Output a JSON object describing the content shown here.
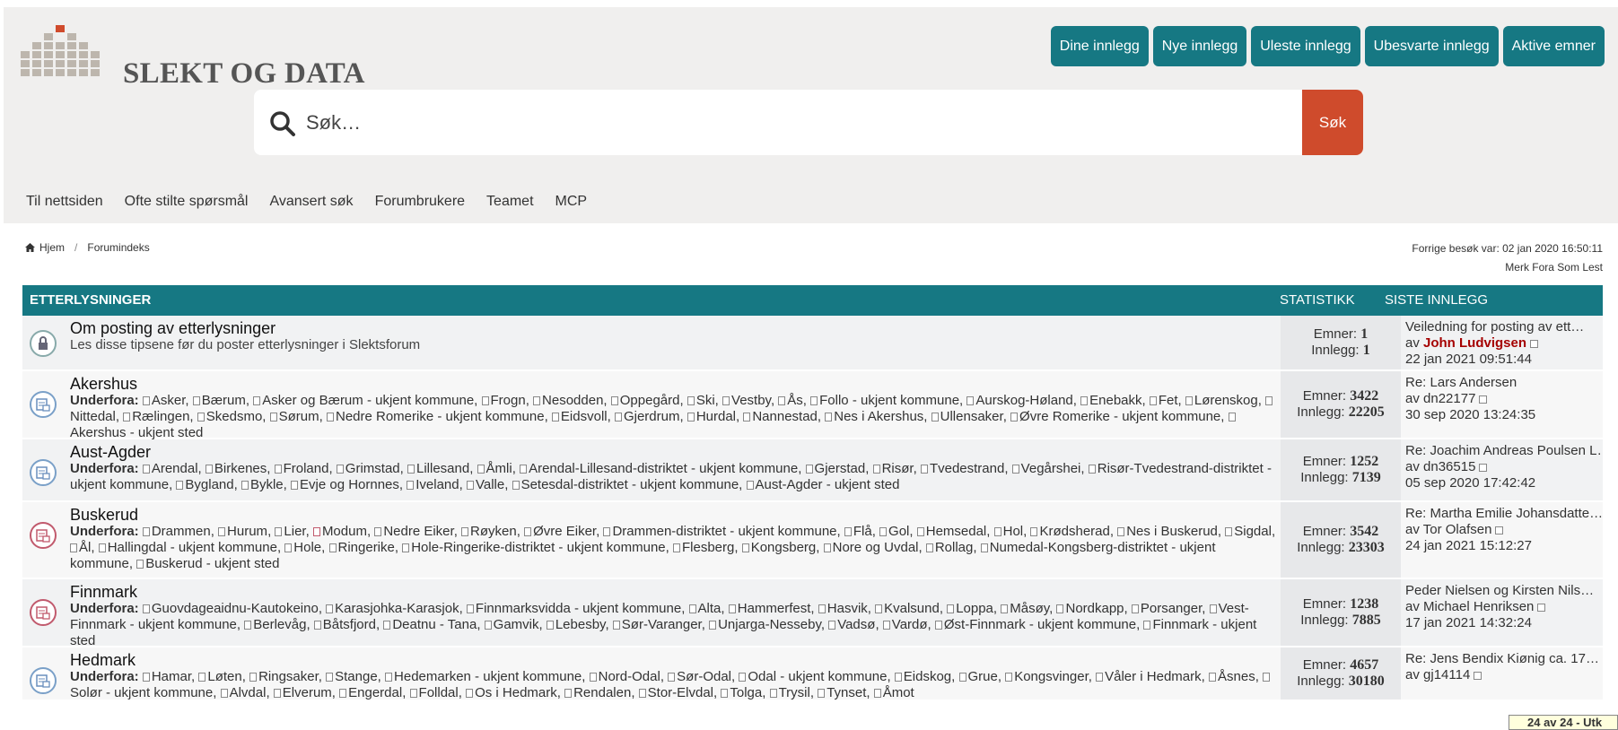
{
  "brand": {
    "name": "SLEKT OG DATA"
  },
  "quick_links": [
    "Dine innlegg",
    "Nye innlegg",
    "Uleste innlegg",
    "Ubesvarte innlegg",
    "Aktive emner"
  ],
  "search": {
    "placeholder": "Søk…",
    "button": "Søk"
  },
  "nav": [
    "Til nettsiden",
    "Ofte stilte spørsmål",
    "Avansert søk",
    "Forumbrukere",
    "Teamet",
    "MCP"
  ],
  "breadcrumb": {
    "home": "Hjem",
    "current": "Forumindeks"
  },
  "last_visit": "Forrige besøk var: 02 jan 2020 16:50:11",
  "mark_read": "Merk Fora Som Lest",
  "table_header": {
    "title": "ETTERLYSNINGER",
    "stats": "STATISTIKK",
    "last": "SISTE INNLEGG"
  },
  "labels": {
    "subforums": "Underfora:",
    "topics": "Emner:",
    "posts": "Innlegg:",
    "by": "av"
  },
  "forums": [
    {
      "title": "Om posting av etterlysninger",
      "description": "Les disse tipsene før du poster etterlysninger i Slektsforum",
      "topics": "1",
      "posts": "1",
      "last_title": "Veiledning for posting av ett…",
      "last_author": "John Ludvigsen",
      "last_date": "22 jan 2021 09:51:44"
    },
    {
      "title": "Akershus",
      "subforums": [
        "Asker",
        "Bærum",
        "Asker og Bærum - ukjent kommune",
        "Frogn",
        "Nesodden",
        "Oppegård",
        "Ski",
        "Vestby",
        "Ås",
        "Follo - ukjent kommune",
        "Aurskog-Høland",
        "Enebakk",
        "Fet",
        "Lørenskog",
        "Nittedal",
        "Rælingen",
        "Skedsmo",
        "Sørum",
        "Nedre Romerike - ukjent kommune",
        "Eidsvoll",
        "Gjerdrum",
        "Hurdal",
        "Nannestad",
        "Nes i Akershus",
        "Ullensaker",
        "Øvre Romerike - ukjent kommune",
        "Akershus - ukjent sted"
      ],
      "topics": "3422",
      "posts": "22205",
      "last_title": "Re: Lars Andersen",
      "last_author": "dn22177",
      "last_date": "30 sep 2020 13:24:35"
    },
    {
      "title": "Aust-Agder",
      "subforums": [
        "Arendal",
        "Birkenes",
        "Froland",
        "Grimstad",
        "Lillesand",
        "Åmli",
        "Arendal-Lillesand-distriktet - ukjent kommune",
        "Gjerstad",
        "Risør",
        "Tvedestrand",
        "Vegårshei",
        "Risør-Tvedestrand-distriktet - ukjent kommune",
        "Bygland",
        "Bykle",
        "Evje og Hornnes",
        "Iveland",
        "Valle",
        "Setesdal-distriktet - ukjent kommune",
        "Aust-Agder - ukjent sted"
      ],
      "topics": "1252",
      "posts": "7139",
      "last_title": "Re: Joachim Andreas Poulsen L…",
      "last_author": "dn36515",
      "last_date": "05 sep 2020 17:42:42"
    },
    {
      "title": "Buskerud",
      "subforums": [
        "Drammen",
        "Hurum",
        "Lier",
        "Modum",
        "Nedre Eiker",
        "Røyken",
        "Øvre Eiker",
        "Drammen-distriktet - ukjent kommune",
        "Flå",
        "Gol",
        "Hemsedal",
        "Hol",
        "Krødsherad",
        "Nes i Buskerud",
        "Sigdal",
        "Ål",
        "Hallingdal - ukjent kommune",
        "Hole",
        "Ringerike",
        "Hole-Ringerike-distriktet - ukjent kommune",
        "Flesberg",
        "Kongsberg",
        "Nore og Uvdal",
        "Rollag",
        "Numedal-Kongsberg-distriktet - ukjent kommune",
        "Buskerud - ukjent sted"
      ],
      "topics": "3542",
      "posts": "23303",
      "last_title": "Re: Martha Emilie Johansdatte…",
      "last_author": "Tor Olafsen",
      "last_date": "24 jan 2021 15:12:27"
    },
    {
      "title": "Finnmark",
      "subforums": [
        "Guovdageaidnu-Kautokeino",
        "Karasjohka-Karasjok",
        "Finnmarksvidda - ukjent kommune",
        "Alta",
        "Hammerfest",
        "Hasvik",
        "Kvalsund",
        "Loppa",
        "Måsøy",
        "Nordkapp",
        "Porsanger",
        "Vest-Finnmark - ukjent kommune",
        "Berlevåg",
        "Båtsfjord",
        "Deatnu - Tana",
        "Gamvik",
        "Lebesby",
        "Sør-Varanger",
        "Unjarga-Nesseby",
        "Vadsø",
        "Vardø",
        "Øst-Finnmark - ukjent kommune",
        "Finnmark - ukjent sted"
      ],
      "topics": "1238",
      "posts": "7885",
      "last_title": "Peder Nielsen og Kirsten Nils…",
      "last_author": "Michael Henriksen",
      "last_date": "17 jan 2021 14:32:24"
    },
    {
      "title": "Hedmark",
      "subforums": [
        "Hamar",
        "Løten",
        "Ringsaker",
        "Stange",
        "Hedemarken - ukjent kommune",
        "Nord-Odal",
        "Sør-Odal",
        "Odal - ukjent kommune",
        "Eidskog",
        "Grue",
        "Kongsvinger",
        "Våler i Hedmark",
        "Åsnes",
        "Solør - ukjent kommune",
        "Alvdal",
        "Elverum",
        "Engerdal",
        "Folldal",
        "Os i Hedmark",
        "Rendalen",
        "Stor-Elvdal",
        "Tolga",
        "Trysil",
        "Tynset",
        "Åmot"
      ],
      "topics": "4657",
      "posts": "30180",
      "last_title": "Re: Jens Bendix Kiønig ca. 17…",
      "last_author": "gj14114",
      "last_date": ""
    }
  ],
  "status_tooltip": "24 av 24 - Utk"
}
